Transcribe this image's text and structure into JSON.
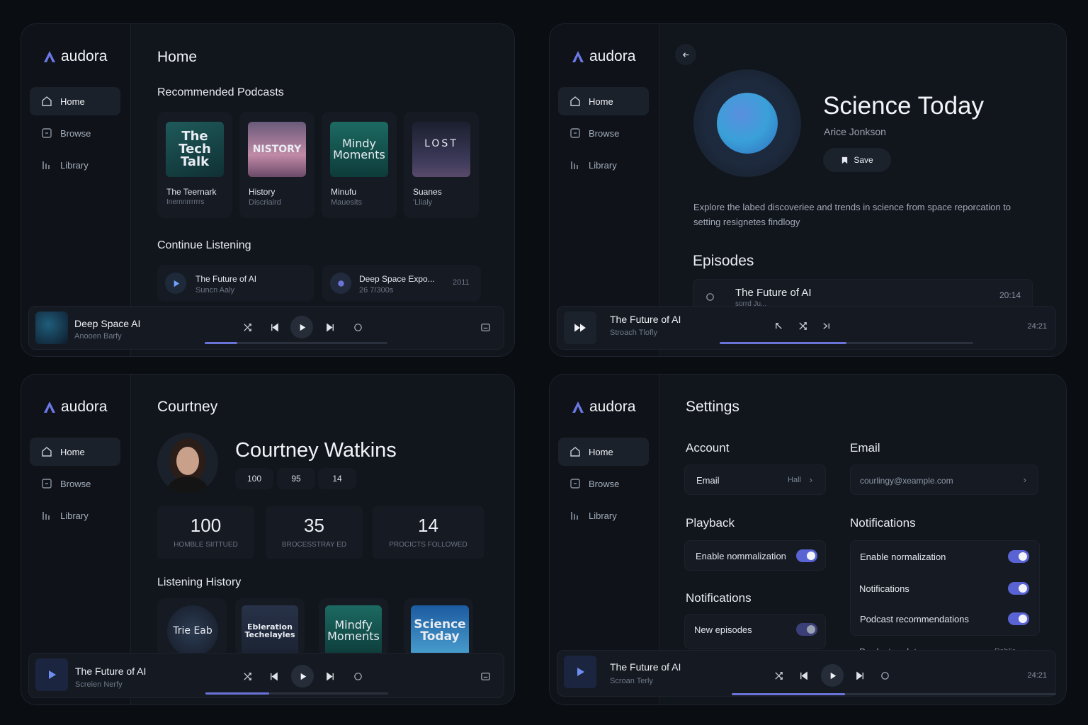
{
  "brand": "audora",
  "nav": [
    "Home",
    "Browse",
    "Library"
  ],
  "home": {
    "title": "Home",
    "recommended_heading": "Recommended Podcasts",
    "podcasts": [
      {
        "cover": "The Tech Talk",
        "title": "The Teernark",
        "sub": "Inernnrrrrrrs"
      },
      {
        "cover": "NISTORY",
        "title": "History",
        "sub": "Discriaird"
      },
      {
        "cover": "Mindy Moments",
        "title": "Minufu",
        "sub": "Mauesits"
      },
      {
        "cover": "LOST",
        "title": "Suanes",
        "sub": "'Llialy"
      }
    ],
    "continue_heading": "Continue Listening",
    "continue": [
      {
        "title": "The Future of AI",
        "sub": "Suncn Aaly",
        "time": ""
      },
      {
        "title": "Deep Space Expo...",
        "sub": "26 7/300s",
        "time": "2011"
      }
    ],
    "player": {
      "title": "Deep Space AI",
      "sub": "Anooen Barfy",
      "progress": 0.18
    }
  },
  "detail": {
    "title": "Science Today",
    "author": "Arice Jonkson",
    "save_label": "Save",
    "description": "Explore the labed discoveriee and trends in science from space reporcation to setting resignetes findlogy",
    "episodes_heading": "Episodes",
    "episode": {
      "title": "The Future of AI",
      "sub": "sorrd Ju...",
      "time": "20:14"
    },
    "player": {
      "title": "The Future of AI",
      "sub": "Stroach Tlofly",
      "time": "24:21",
      "progress": 0.5
    }
  },
  "profile": {
    "title": "Courtney",
    "name": "Courtney Watkins",
    "pills": [
      "100",
      "95",
      "14"
    ],
    "stats": [
      {
        "value": "100",
        "label": "HOMBLE SIITTUED"
      },
      {
        "value": "35",
        "label": "BROCESSTRAY ED"
      },
      {
        "value": "14",
        "label": "PROCICTS FOLLOWED"
      }
    ],
    "history_heading": "Listening History",
    "history": [
      "Trie Eab",
      "Ebleration Techelayles",
      "Mindfy Moments",
      "Science Today"
    ],
    "player": {
      "title": "The Future of AI",
      "sub": "Screien Nerfy",
      "progress": 0.35
    }
  },
  "settings": {
    "title": "Settings",
    "account_heading": "Account",
    "account_row": {
      "label": "Email",
      "value": "Hall"
    },
    "email_heading": "Email",
    "email_value": "courlingy@xeample.com",
    "playback_heading": "Playback",
    "playback_row": "Enable nommalization",
    "notifications_heading": "Notifications",
    "new_episodes": "New episodes",
    "notifications_right_heading": "Notifications",
    "right_rows": [
      {
        "label": "Enable normalization",
        "toggle": true
      },
      {
        "label": "Notifications",
        "toggle": true
      },
      {
        "label": "Podcast recommendations",
        "toggle": true
      }
    ],
    "product_updates": {
      "label": "Product updatee",
      "value": "Pablic"
    },
    "player": {
      "title": "The Future of AI",
      "sub": "Scroan Terly",
      "time": "24:21",
      "progress": 0.35
    }
  },
  "colors": {
    "accent": "#6a74d8",
    "background": "#0a0d12",
    "panel": "#11151c"
  }
}
